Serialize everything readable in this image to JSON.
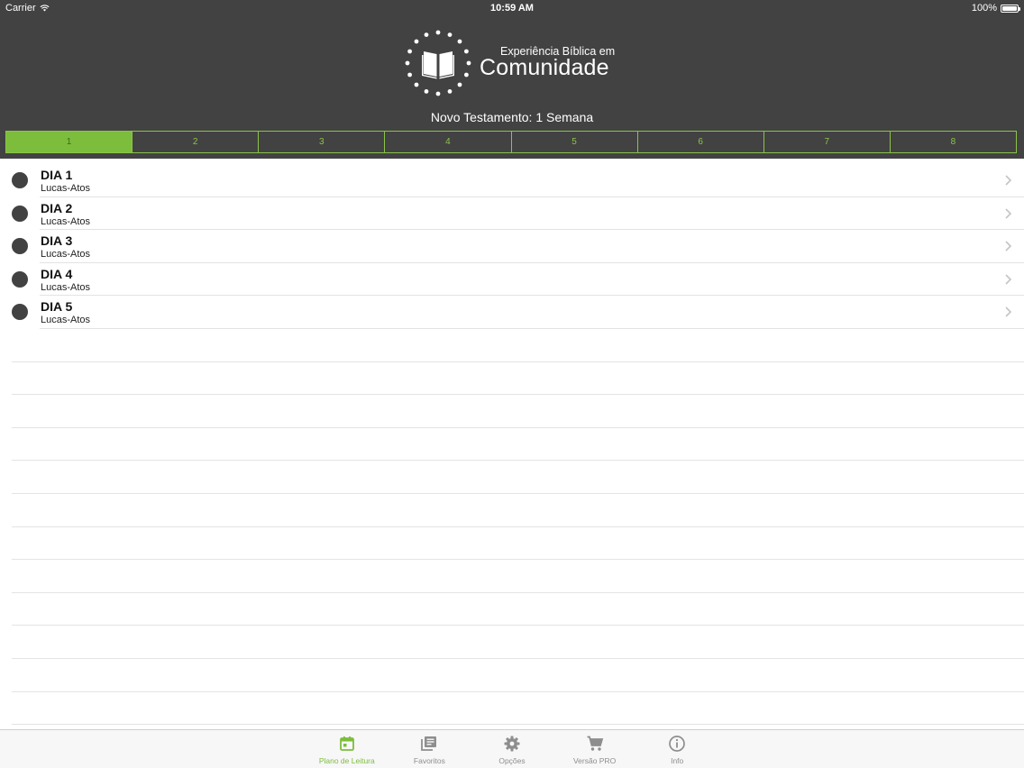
{
  "status_bar": {
    "carrier": "Carrier",
    "time": "10:59 AM",
    "battery": "100%"
  },
  "logo": {
    "line1": "Experiência Bíblica em",
    "line2": "Comunidade"
  },
  "plan": {
    "title": "Novo Testamento: 1 Semana"
  },
  "week_tabs": [
    {
      "label": "1"
    },
    {
      "label": "2"
    },
    {
      "label": "3"
    },
    {
      "label": "4"
    },
    {
      "label": "5"
    },
    {
      "label": "6"
    },
    {
      "label": "7"
    },
    {
      "label": "8"
    }
  ],
  "days": [
    {
      "title": "DIA 1",
      "reading": "Lucas-Atos"
    },
    {
      "title": "DIA 2",
      "reading": "Lucas-Atos"
    },
    {
      "title": "DIA 3",
      "reading": "Lucas-Atos"
    },
    {
      "title": "DIA 4",
      "reading": "Lucas-Atos"
    },
    {
      "title": "DIA 5",
      "reading": "Lucas-Atos"
    }
  ],
  "tab_bar": [
    {
      "label": "Plano de Leitura",
      "icon": "calendar-icon"
    },
    {
      "label": "Favoritos",
      "icon": "library-icon"
    },
    {
      "label": "Opções",
      "icon": "gear-icon"
    },
    {
      "label": "Versão PRO",
      "icon": "cart-icon"
    },
    {
      "label": "Info",
      "icon": "info-icon"
    }
  ],
  "colors": {
    "header": "#424242",
    "accent": "#7cbd3c",
    "tab_inactive": "#8e8e8e"
  }
}
